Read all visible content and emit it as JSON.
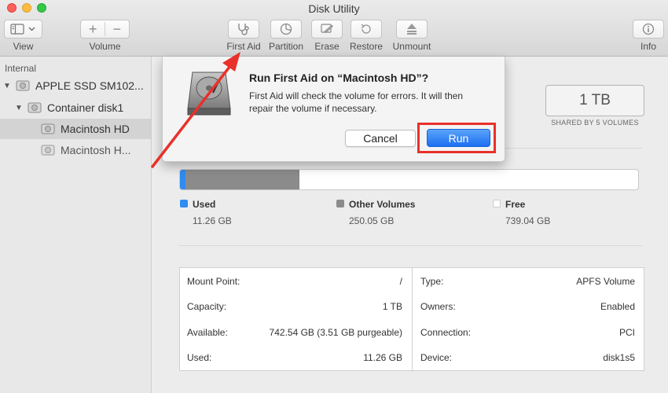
{
  "window": {
    "title": "Disk Utility"
  },
  "toolbar": {
    "view_label": "View",
    "volume_label": "Volume",
    "first_aid_label": "First Aid",
    "partition_label": "Partition",
    "erase_label": "Erase",
    "restore_label": "Restore",
    "unmount_label": "Unmount",
    "info_label": "Info"
  },
  "sidebar": {
    "section": "Internal",
    "items": [
      {
        "label": "APPLE SSD SM102..."
      },
      {
        "label": "Container disk1"
      },
      {
        "label": "Macintosh HD"
      },
      {
        "label": "Macintosh H..."
      }
    ]
  },
  "capacity": {
    "value": "1 TB",
    "shared": "SHARED BY 5 VOLUMES"
  },
  "usage": {
    "used_fraction": 0.0113,
    "other_fraction": 0.25,
    "used": {
      "name": "Used",
      "value": "11.26 GB",
      "color": "#2f8cf2"
    },
    "other": {
      "name": "Other Volumes",
      "value": "250.05 GB",
      "color": "#8b8b8b"
    },
    "free": {
      "name": "Free",
      "value": "739.04 GB",
      "color": "#ffffff"
    }
  },
  "info": {
    "left": [
      {
        "label": "Mount Point:",
        "value": "/"
      },
      {
        "label": "Capacity:",
        "value": "1 TB"
      },
      {
        "label": "Available:",
        "value": "742.54 GB (3.51 GB purgeable)"
      },
      {
        "label": "Used:",
        "value": "11.26 GB"
      }
    ],
    "right": [
      {
        "label": "Type:",
        "value": "APFS Volume"
      },
      {
        "label": "Owners:",
        "value": "Enabled"
      },
      {
        "label": "Connection:",
        "value": "PCI"
      },
      {
        "label": "Device:",
        "value": "disk1s5"
      }
    ]
  },
  "dialog": {
    "title": "Run First Aid on “Macintosh HD”?",
    "message": "First Aid will check the volume for errors. It will then repair the volume if necessary.",
    "cancel_label": "Cancel",
    "run_label": "Run"
  },
  "colors": {
    "annotation": "#e8312a",
    "accent": "#1d6ff0"
  }
}
